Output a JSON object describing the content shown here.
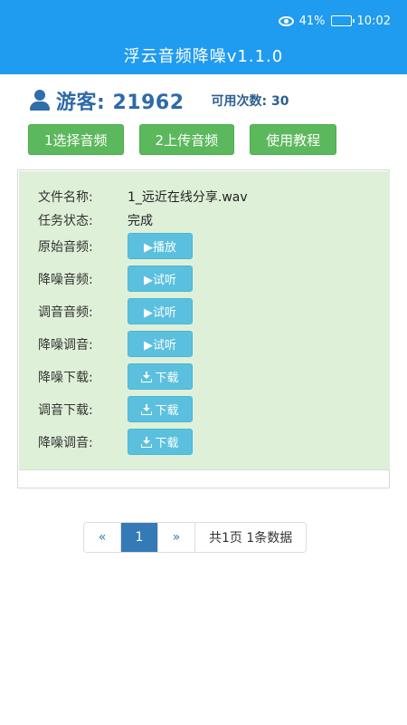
{
  "status": {
    "battery": "41%",
    "battery_level": 0.41,
    "time": "10:02",
    "icons": [
      "eye-icon",
      "battery-icon"
    ]
  },
  "header": {
    "title": "浮云音频降噪v1.1.0",
    "color": "#1f9bf0"
  },
  "user": {
    "visitor": "游客: 21962",
    "uses": "可用次数: 30",
    "icon": "user-icon"
  },
  "actions": {
    "select": "1选择音频",
    "upload": "2上传音频",
    "tutorial": "使用教程"
  },
  "task": {
    "file_label": "文件名称:",
    "file_name": "1_远近在线分享.wav",
    "status_label": "任务状态:",
    "status_value": "完成",
    "rows": [
      {
        "label": "原始音频:",
        "button": "▶播放",
        "icon": "play-icon"
      },
      {
        "label": "降噪音频:",
        "button": "▶试听",
        "icon": "play-icon"
      },
      {
        "label": "调音音频:",
        "button": "▶试听",
        "icon": "play-icon"
      },
      {
        "label": "降噪调音:",
        "button": "▶试听",
        "icon": "play-icon"
      },
      {
        "label": "降噪下载:",
        "button": "下载",
        "icon": "download-icon"
      },
      {
        "label": "调音下载:",
        "button": "下载",
        "icon": "download-icon"
      },
      {
        "label": "降噪调音:",
        "button": "下载",
        "icon": "download-icon"
      }
    ]
  },
  "pagination": {
    "prev": "«",
    "page": "1",
    "next": "»",
    "info": "共1页 1条数据"
  }
}
